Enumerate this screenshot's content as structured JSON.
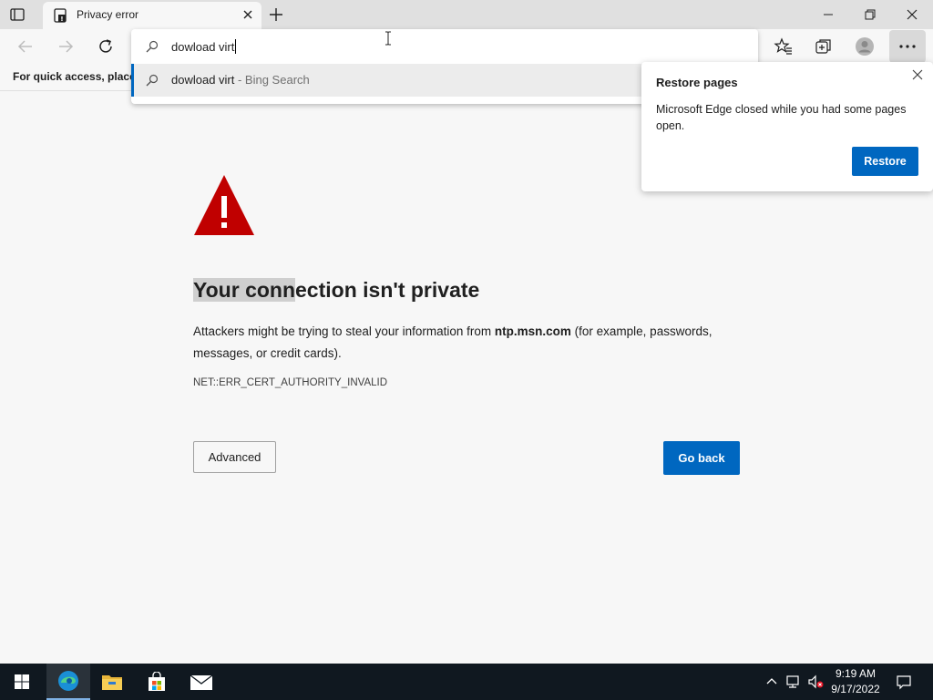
{
  "browser": {
    "tab_title": "Privacy error",
    "favorites_bar_text": "For quick access, place your favorites here on the favorites bar."
  },
  "omnibox": {
    "value": "dowload virt",
    "suggestion_text": "dowload virt",
    "suggestion_source": " - Bing Search"
  },
  "restore_popup": {
    "title": "Restore pages",
    "body": "Microsoft Edge closed while you had some pages open.",
    "button_label": "Restore"
  },
  "error_page": {
    "heading_highlighted": "Your conn",
    "heading_rest": "ection isn't private",
    "desc_before": "Attackers might be trying to steal your information from ",
    "desc_domain": "ntp.msn.com",
    "desc_after": " (for example, passwords, messages, or credit cards).",
    "error_code": "NET::ERR_CERT_AUTHORITY_INVALID",
    "advanced_label": "Advanced",
    "go_back_label": "Go back"
  },
  "taskbar": {
    "time": "9:19 AM",
    "date": "9/17/2022"
  },
  "colors": {
    "accent": "#0067c0",
    "warning": "#c00000"
  }
}
